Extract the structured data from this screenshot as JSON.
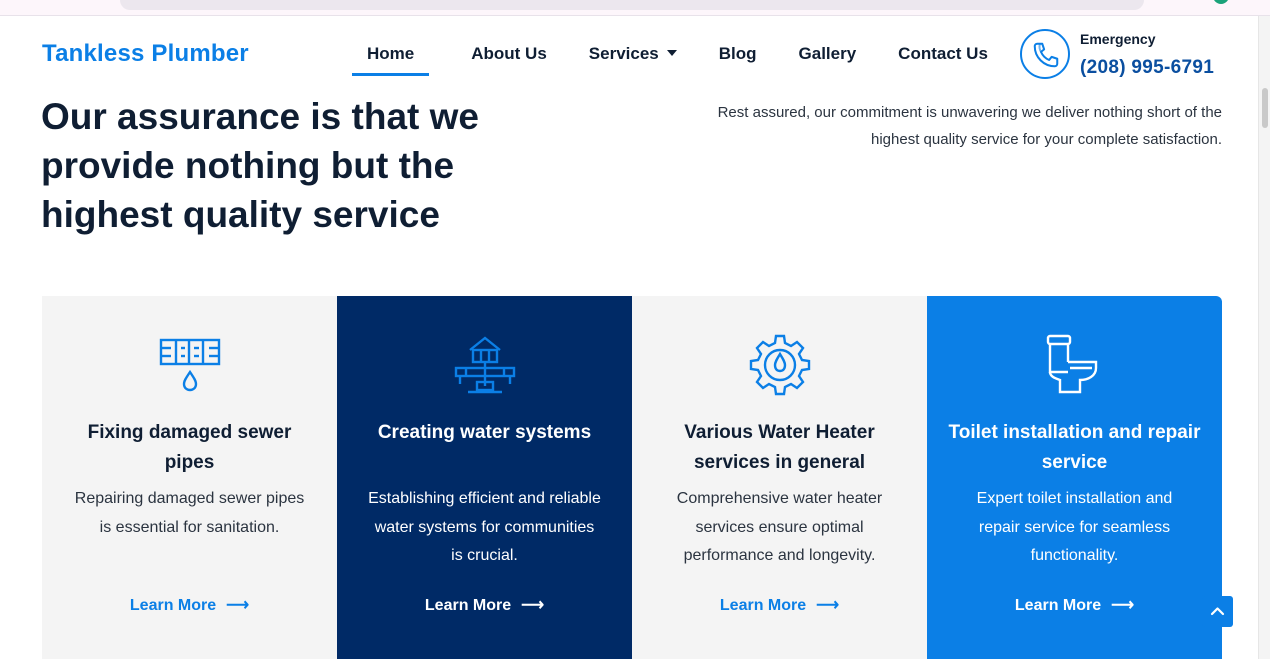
{
  "header": {
    "logo": "Tankless Plumber",
    "nav": [
      "Home",
      "About Us",
      "Services",
      "Blog",
      "Gallery",
      "Contact Us"
    ],
    "emergency_label": "Emergency",
    "emergency_phone": "(208) 995-6791"
  },
  "hero": {
    "heading": "Our assurance is that we provide nothing but the highest quality service",
    "intro": "Rest assured, our commitment is unwavering we deliver nothing short of the highest quality service for your complete satisfaction."
  },
  "cards": [
    {
      "title": "Fixing damaged sewer pipes",
      "desc": "Repairing damaged sewer pipes is essential for sanitation.",
      "link": "Learn More",
      "icon": "pipe-leak-icon"
    },
    {
      "title": "Creating water systems",
      "desc": "Establishing efficient and reliable water systems for communities is crucial.",
      "link": "Learn More",
      "icon": "water-system-icon"
    },
    {
      "title": "Various Water Heater services in general",
      "desc": "Comprehensive water heater services ensure optimal performance and longevity.",
      "link": "Learn More",
      "icon": "gear-drop-icon"
    },
    {
      "title": "Toilet installation and repair service",
      "desc": "Expert toilet installation and repair service for seamless functionality.",
      "link": "Learn More",
      "icon": "toilet-icon"
    }
  ],
  "colors": {
    "brand_blue": "#0b7fe6",
    "navy": "#002a66",
    "text_dark": "#0f1e33",
    "card_light": "#f4f4f4"
  }
}
